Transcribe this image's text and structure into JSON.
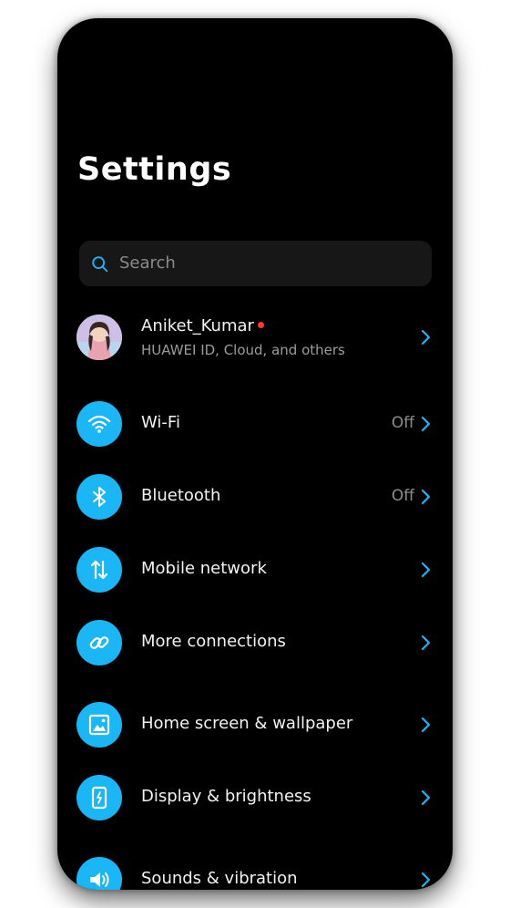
{
  "header": {
    "title": "Settings"
  },
  "search": {
    "placeholder": "Search"
  },
  "account": {
    "name": "Aniket_Kumar",
    "subtitle": "HUAWEI ID, Cloud, and others"
  },
  "items": [
    {
      "label": "Wi-Fi",
      "value": "Off",
      "icon": "wifi-icon"
    },
    {
      "label": "Bluetooth",
      "value": "Off",
      "icon": "bluetooth-icon"
    },
    {
      "label": "Mobile network",
      "value": "",
      "icon": "mobile-network-icon"
    },
    {
      "label": "More connections",
      "value": "",
      "icon": "link-icon"
    },
    {
      "label": "Home screen & wallpaper",
      "value": "",
      "icon": "image-icon"
    },
    {
      "label": "Display & brightness",
      "value": "",
      "icon": "display-icon"
    },
    {
      "label": "Sounds & vibration",
      "value": "",
      "icon": "speaker-icon"
    }
  ],
  "colors": {
    "accent": "#1ab6f5",
    "background": "#000000",
    "notification_dot": "#ff3b30"
  }
}
